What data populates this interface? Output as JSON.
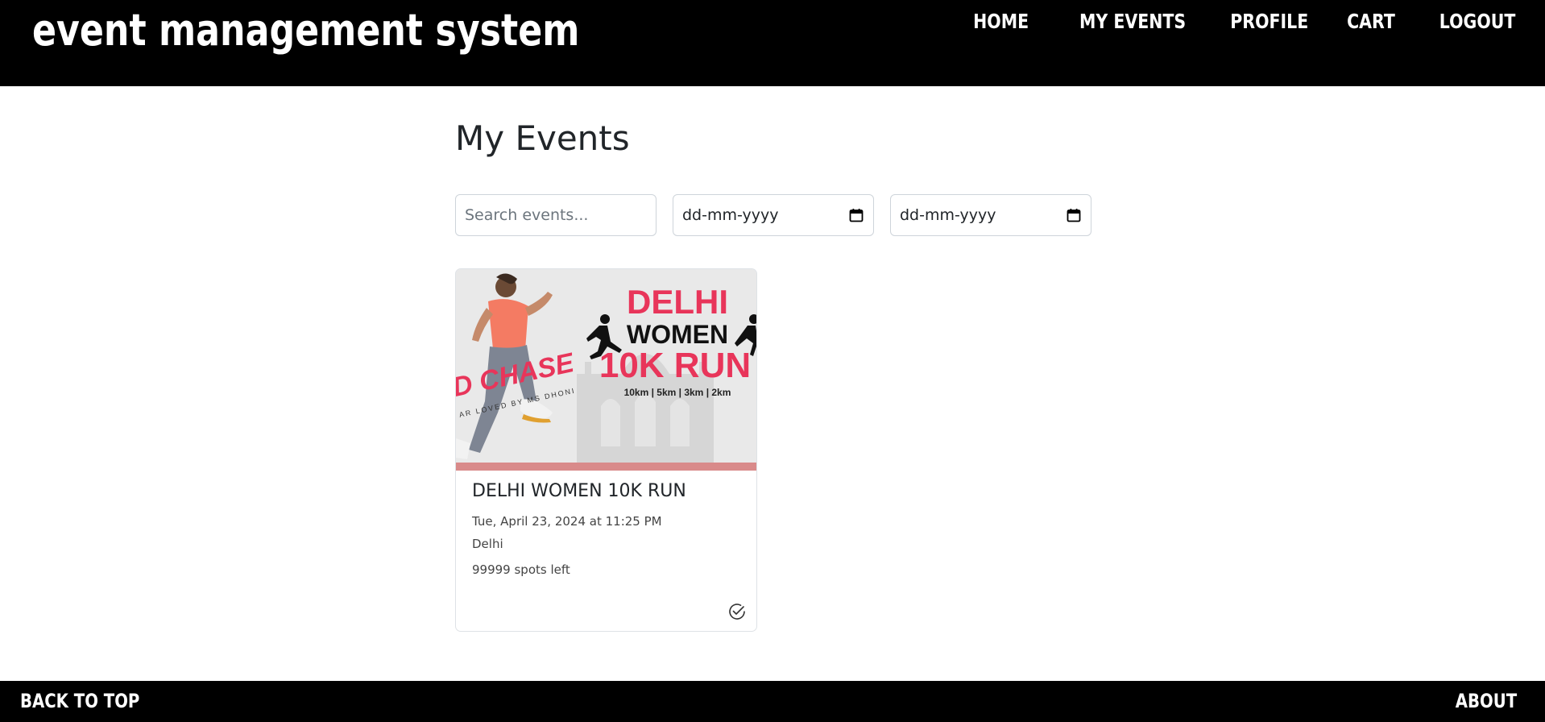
{
  "header": {
    "brand": "event management system",
    "nav": [
      "Home",
      "MY EVENTS",
      "PROFILE",
      "CART",
      "LOGOUT"
    ]
  },
  "main": {
    "title": "My Events",
    "search": {
      "placeholder": "Search events..."
    },
    "date_from": {
      "value": "dd-mm-yyyy"
    },
    "date_to": {
      "value": "dd-mm-yyyy"
    }
  },
  "events": [
    {
      "image_text": {
        "title_line1": "DELHI",
        "title_line2": "WOMEN",
        "title_line3": "10K RUN",
        "distances": "10km | 5km | 3km | 2km",
        "slogan": "D CHASE",
        "tagline": "AR LOVED BY MS DHONI"
      },
      "title": "DELHI WOMEN 10K RUN",
      "date": "Tue, April 23, 2024 at 11:25 PM",
      "location": "Delhi",
      "spots": "99999 spots left",
      "status_icon": "check-circle-icon"
    }
  ],
  "footer": {
    "back_to_top": "BACK TO TOP",
    "about": "ABOUT"
  },
  "colors": {
    "header_bg": "#000000",
    "footer_bg": "#000000",
    "accent_pink": "#e8355a",
    "text": "#212529"
  }
}
